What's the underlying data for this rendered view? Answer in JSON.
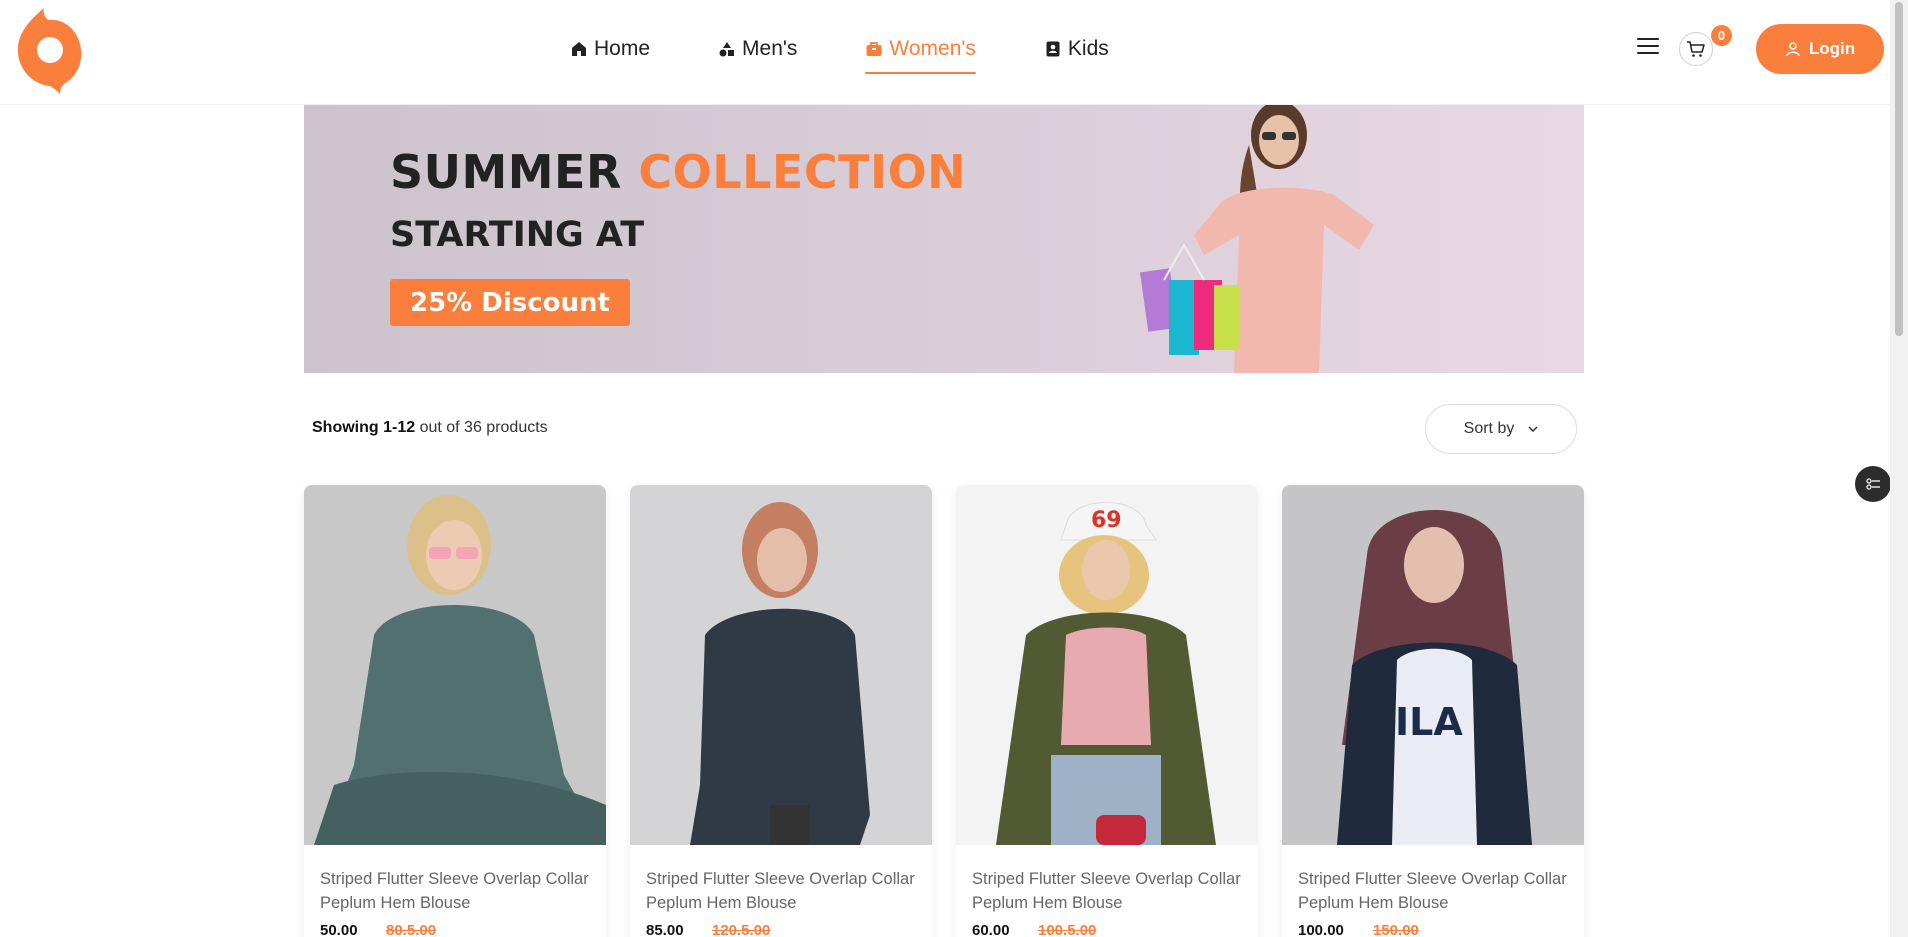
{
  "header": {
    "nav": [
      {
        "label": "Home",
        "icon": "home-icon"
      },
      {
        "label": "Men's",
        "icon": "shapes-icon"
      },
      {
        "label": "Women's",
        "icon": "bag-icon",
        "active": true
      },
      {
        "label": "Kids",
        "icon": "contact-book-icon"
      }
    ],
    "cart_count": "0",
    "login_label": "Login"
  },
  "banner": {
    "line1_a": "SUMMER",
    "line1_b": "COLLECTION",
    "line2": "STARTING AT",
    "discount": "25% Discount"
  },
  "toolbar": {
    "showing_bold": "Showing 1-12",
    "showing_rest": " out of 36 products",
    "sort_label": "Sort by"
  },
  "products": [
    {
      "name": "Striped Flutter Sleeve Overlap Collar Peplum Hem Blouse",
      "price": "50.00",
      "old_price": "80.5.00"
    },
    {
      "name": "Striped Flutter Sleeve Overlap Collar Peplum Hem Blouse",
      "price": "85.00",
      "old_price": "120.5.00"
    },
    {
      "name": "Striped Flutter Sleeve Overlap Collar Peplum Hem Blouse",
      "price": "60.00",
      "old_price": "100.5.00"
    },
    {
      "name": "Striped Flutter Sleeve Overlap Collar Peplum Hem Blouse",
      "price": "100.00",
      "old_price": "150.00"
    }
  ],
  "colors": {
    "accent": "#fb7f3c",
    "dark": "#222222"
  }
}
